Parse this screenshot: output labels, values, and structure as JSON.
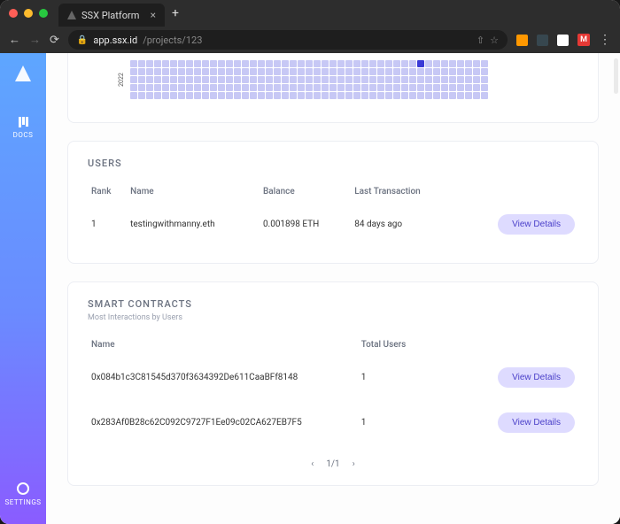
{
  "browser": {
    "tab_title": "SSX Platform",
    "url_host": "app.ssx.id",
    "url_path": "/projects/123",
    "avatar_letter": "M"
  },
  "sidebar": {
    "docs_label": "DOCS",
    "settings_label": "SETTINGS"
  },
  "heatmap": {
    "year": "2022",
    "rows": 5,
    "cols": 45,
    "active_index": 180
  },
  "users": {
    "title": "USERS",
    "columns": {
      "rank": "Rank",
      "name": "Name",
      "balance": "Balance",
      "last_tx": "Last Transaction"
    },
    "rows": [
      {
        "rank": "1",
        "name": "testingwithmanny.eth",
        "balance": "0.001898 ETH",
        "last_tx": "84 days ago",
        "action": "View Details"
      }
    ]
  },
  "contracts": {
    "title": "SMART CONTRACTS",
    "subtitle": "Most Interactions by Users",
    "columns": {
      "name": "Name",
      "total_users": "Total Users"
    },
    "rows": [
      {
        "name": "0x084b1c3C81545d370f3634392De611CaaBFf8148",
        "total_users": "1",
        "action": "View Details"
      },
      {
        "name": "0x283Af0B28c62C092C9727F1Ee09c02CA627EB7F5",
        "total_users": "1",
        "action": "View Details"
      }
    ],
    "pager": {
      "prev": "‹",
      "label": "1/1",
      "next": "›"
    }
  }
}
